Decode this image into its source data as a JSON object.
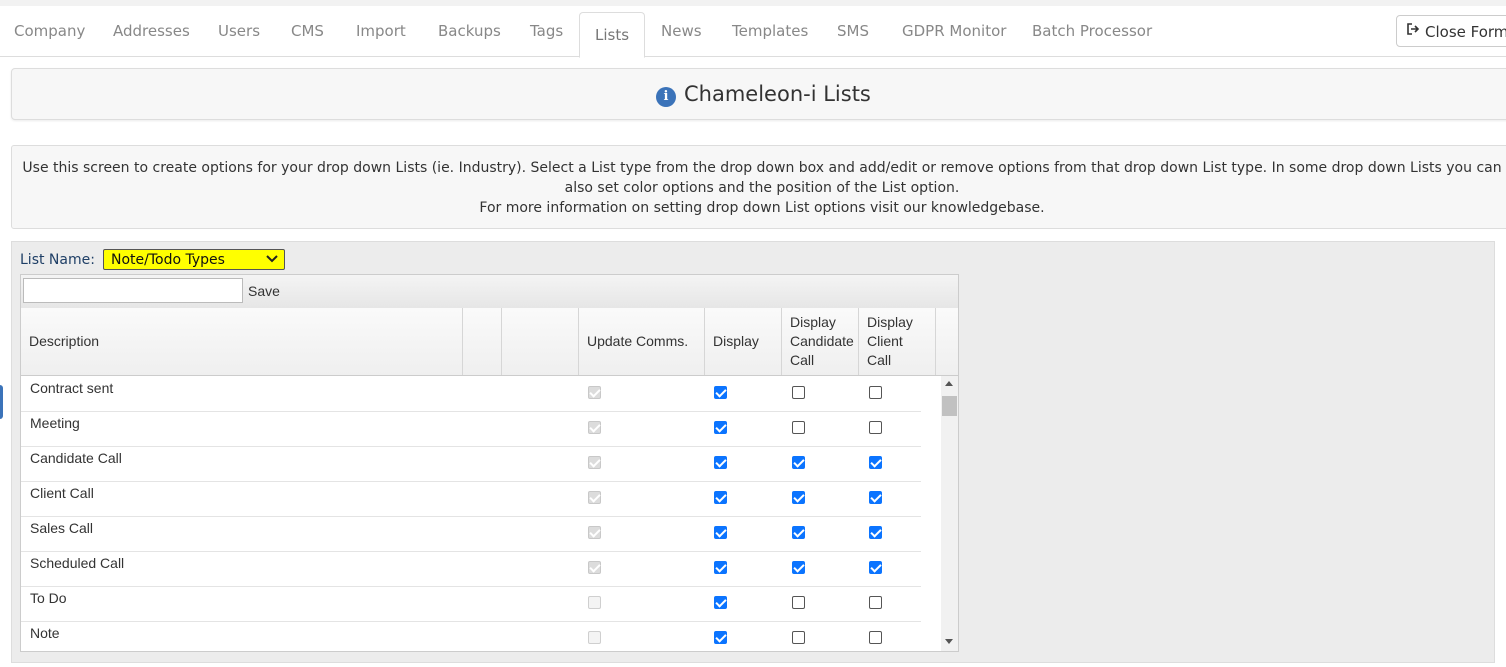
{
  "tabs": [
    {
      "label": "Company"
    },
    {
      "label": "Addresses"
    },
    {
      "label": "Users"
    },
    {
      "label": "CMS"
    },
    {
      "label": "Import"
    },
    {
      "label": "Backups"
    },
    {
      "label": "Tags"
    },
    {
      "label": "Lists"
    },
    {
      "label": "News"
    },
    {
      "label": "Templates"
    },
    {
      "label": "SMS"
    },
    {
      "label": "GDPR Monitor"
    },
    {
      "label": "Batch Processor"
    }
  ],
  "active_tab": "Lists",
  "close_form": {
    "label": "Close Form",
    "icon": "sign-out-icon"
  },
  "page_title": {
    "icon": "info-icon",
    "icon_glyph": "i",
    "text": "Chameleon-i Lists"
  },
  "description": {
    "line1": "Use this screen to create options for your drop down Lists (ie. Industry). Select a List type from the drop down box and add/edit or remove options from that drop down List type. In some drop down Lists you can",
    "line2": "also set color options and the position of the List option.",
    "line3": "For more information on setting drop down List options visit our knowledgebase."
  },
  "list_name": {
    "label": "List Name:",
    "selected": "Note/Todo Types",
    "highlight_color": "#ffff00"
  },
  "toolbar": {
    "input_value": "",
    "save_label": "Save"
  },
  "columns": {
    "description": "Description",
    "blank1": "",
    "blank2": "",
    "update_comms": "Update Comms.",
    "display": "Display",
    "display_candidate_call": [
      "Display",
      "Candidate",
      "Call"
    ],
    "display_client_call": [
      "Display",
      "Client",
      "Call"
    ]
  },
  "rows": [
    {
      "description": "Contract sent",
      "update_comms": true,
      "update_comms_disabled": true,
      "display": true,
      "display_candidate_call": false,
      "display_client_call": false
    },
    {
      "description": "Meeting",
      "update_comms": true,
      "update_comms_disabled": true,
      "display": true,
      "display_candidate_call": false,
      "display_client_call": false
    },
    {
      "description": "Candidate Call",
      "update_comms": true,
      "update_comms_disabled": true,
      "display": true,
      "display_candidate_call": true,
      "display_client_call": true
    },
    {
      "description": "Client Call",
      "update_comms": true,
      "update_comms_disabled": true,
      "display": true,
      "display_candidate_call": true,
      "display_client_call": true
    },
    {
      "description": "Sales Call",
      "update_comms": true,
      "update_comms_disabled": true,
      "display": true,
      "display_candidate_call": true,
      "display_client_call": true
    },
    {
      "description": "Scheduled Call",
      "update_comms": true,
      "update_comms_disabled": true,
      "display": true,
      "display_candidate_call": true,
      "display_client_call": true
    },
    {
      "description": "To Do",
      "update_comms": false,
      "update_comms_disabled": true,
      "display": true,
      "display_candidate_call": false,
      "display_client_call": false
    },
    {
      "description": "Note",
      "update_comms": false,
      "update_comms_disabled": true,
      "display": true,
      "display_candidate_call": false,
      "display_client_call": false
    }
  ],
  "colors": {
    "checkbox_on": "#0b74ff",
    "info_icon": "#3b73b9",
    "select_highlight": "#ffff00"
  }
}
